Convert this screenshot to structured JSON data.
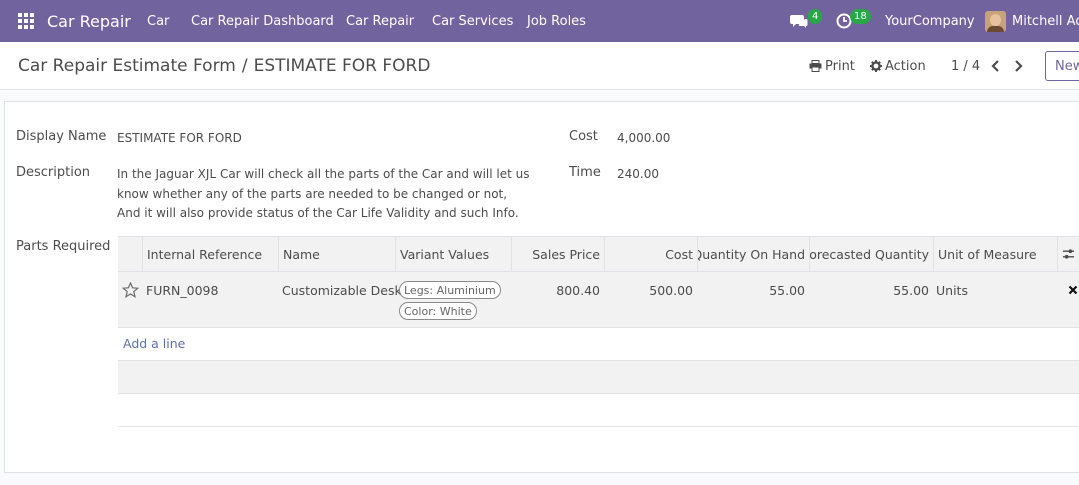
{
  "navbar": {
    "brand": "Car Repair",
    "menu": [
      "Car",
      "Car Repair Dashboard",
      "Car Repair",
      "Car Services",
      "Job Roles"
    ],
    "messages_count": "4",
    "activities_count": "18",
    "company": "YourCompany",
    "user": "Mitchell Admin",
    "accent_color": "#71639e",
    "badge_color": "#28a745"
  },
  "control_panel": {
    "breadcrumb_parent": "Car Repair Estimate Form",
    "breadcrumb_separator": "/",
    "breadcrumb_current": "ESTIMATE FOR FORD",
    "print_label": "Print",
    "action_label": "Action",
    "pager": "1 / 4",
    "new_label": "New"
  },
  "form": {
    "display_name_label": "Display Name",
    "display_name": "ESTIMATE FOR FORD",
    "description_label": "Description",
    "description": " In the Jaguar XJL Car will check all the parts of the Car and will let us know whether any of the parts are needed to be changed or not, And it will also provide status of the Car Life Validity and such Info.",
    "cost_label": "Cost",
    "cost": "4,000.00",
    "time_label": "Time",
    "time": "240.00",
    "parts_label": "Parts Required"
  },
  "parts_table": {
    "columns": [
      "Internal Reference",
      "Name",
      "Variant Values",
      "Sales Price",
      "Cost",
      "Quantity On Hand",
      "Forecasted Quantity",
      "Unit of Measure"
    ],
    "rows": [
      {
        "internal_reference": "FURN_0098",
        "name": "Customizable Desk",
        "variants": [
          "Legs: Aluminium",
          "Color: White"
        ],
        "sales_price": "800.40",
        "cost": "500.00",
        "qty_on_hand": "55.00",
        "forecasted_qty": "55.00",
        "uom": "Units"
      }
    ],
    "add_line": "Add a line"
  },
  "icons": {
    "apps": "apps-grid-icon",
    "messages": "chat-icon",
    "activities": "clock-icon",
    "print": "print-icon",
    "action": "gear-icon",
    "prev": "chevron-left-icon",
    "next": "chevron-right-icon",
    "favorite": "star-icon",
    "delete": "close-icon",
    "optional_columns": "sliders-icon"
  }
}
